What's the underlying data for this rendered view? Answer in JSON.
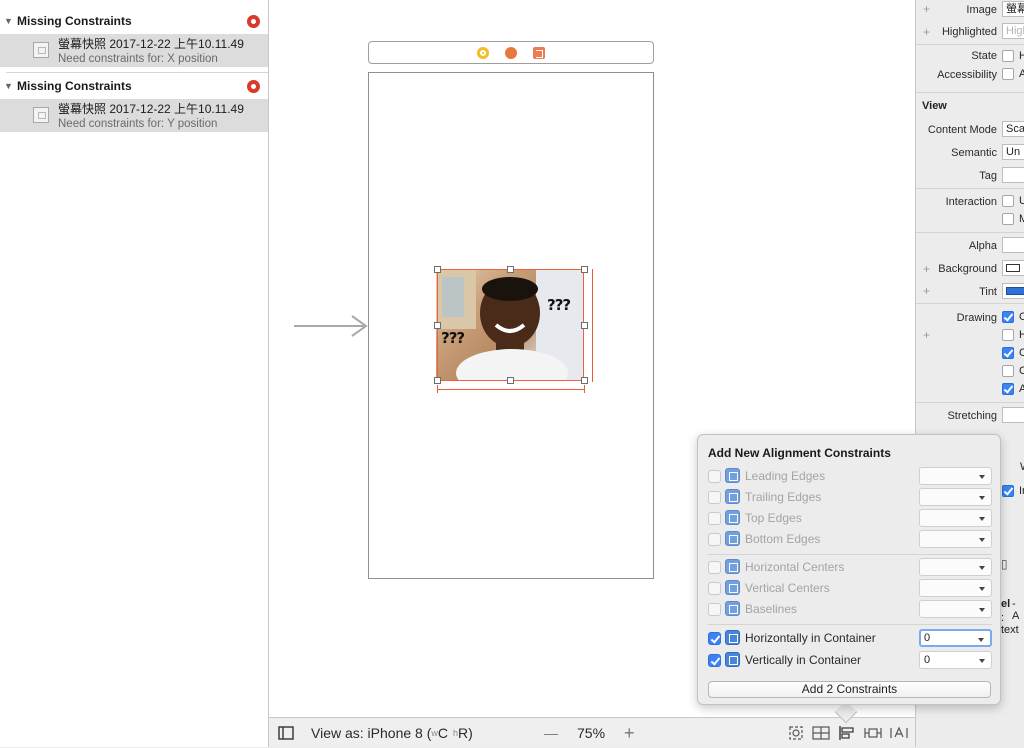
{
  "issues": {
    "groups": [
      {
        "title": "Missing Constraints",
        "item_title": "螢幕快照 2017-12-22 上午10.11.49",
        "item_detail": "Need constraints for: X position"
      },
      {
        "title": "Missing Constraints",
        "item_title": "螢幕快照 2017-12-22 上午10.11.49",
        "item_detail": "Need constraints for: Y position"
      }
    ]
  },
  "canvas": {
    "image_text_left": "???",
    "image_text_right": "???"
  },
  "bottom_bar": {
    "view_as_prefix": "View as: iPhone 8 (",
    "size_w": "w",
    "size_c": "C",
    "size_h": "h",
    "size_r": "R",
    "view_as_suffix": ")",
    "zoom_minus": "—",
    "zoom_value": "75%",
    "zoom_plus": "+"
  },
  "inspector": {
    "image_label": "Image",
    "image_value": "螢幕",
    "highlighted_label": "Highlighted",
    "highlighted_placeholder": "High",
    "state_label": "State",
    "state_option": "H",
    "accessibility_label": "Accessibility",
    "accessibility_option": "A",
    "view_section": "View",
    "content_mode_label": "Content Mode",
    "content_mode_value": "Sca",
    "semantic_label": "Semantic",
    "semantic_value": "Un",
    "tag_label": "Tag",
    "interaction_label": "Interaction",
    "interaction_opt1": "U",
    "interaction_opt2": "M",
    "alpha_label": "Alpha",
    "background_label": "Background",
    "tint_label": "Tint",
    "drawing_label": "Drawing",
    "drawing_opts": [
      "O",
      "H",
      "C",
      "C",
      "A"
    ],
    "stretching_label": "Stretching",
    "partial_w": "W",
    "partial_in": "In",
    "partial_el": "el",
    "partial_dash_a": "- A",
    "partial_text": ": text",
    "accent_blue": "#3b83f5"
  },
  "popover": {
    "title": "Add New Alignment Constraints",
    "rows": [
      {
        "label": "Leading Edges",
        "checked": false,
        "value": ""
      },
      {
        "label": "Trailing Edges",
        "checked": false,
        "value": ""
      },
      {
        "label": "Top Edges",
        "checked": false,
        "value": ""
      },
      {
        "label": "Bottom Edges",
        "checked": false,
        "value": ""
      },
      {
        "label": "Horizontal Centers",
        "checked": false,
        "value": ""
      },
      {
        "label": "Vertical Centers",
        "checked": false,
        "value": ""
      },
      {
        "label": "Baselines",
        "checked": false,
        "value": ""
      },
      {
        "label": "Horizontally in Container",
        "checked": true,
        "value": "0"
      },
      {
        "label": "Vertically in Container",
        "checked": true,
        "value": "0"
      }
    ],
    "add_button": "Add 2 Constraints"
  },
  "colors": {
    "error_red": "#d63b2c",
    "constraint_orange": "#ee5a34",
    "checkbox_blue": "#3b83f5"
  }
}
